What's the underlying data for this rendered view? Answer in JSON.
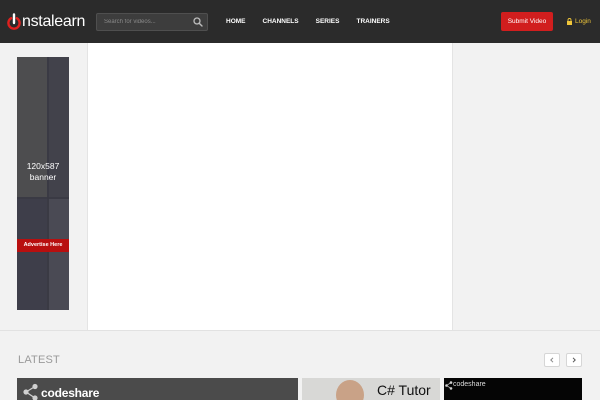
{
  "header": {
    "logo_text": "nstalearn",
    "search_placeholder": "Search for videos...",
    "nav": [
      {
        "label": "HOME"
      },
      {
        "label": "CHANNELS"
      },
      {
        "label": "SERIES"
      },
      {
        "label": "TRAINERS"
      }
    ],
    "submit_label": "Submit Video",
    "login_label": "Login"
  },
  "banner": {
    "line1": "120x587",
    "line2": "banner",
    "cta": "Advertise Here"
  },
  "latest": {
    "heading": "LATEST",
    "prev_icon": "chevron-left-icon",
    "next_icon": "chevron-right-icon",
    "videos": [
      {
        "brand": "codeshare"
      },
      {
        "title": "C# Tutor"
      },
      {
        "brand": "codeshare"
      }
    ]
  },
  "colors": {
    "header_bg": "#2b2b2b",
    "accent_red": "#d11e1e",
    "login_yellow": "#f0c63a",
    "page_bg": "#f2f2f2"
  }
}
